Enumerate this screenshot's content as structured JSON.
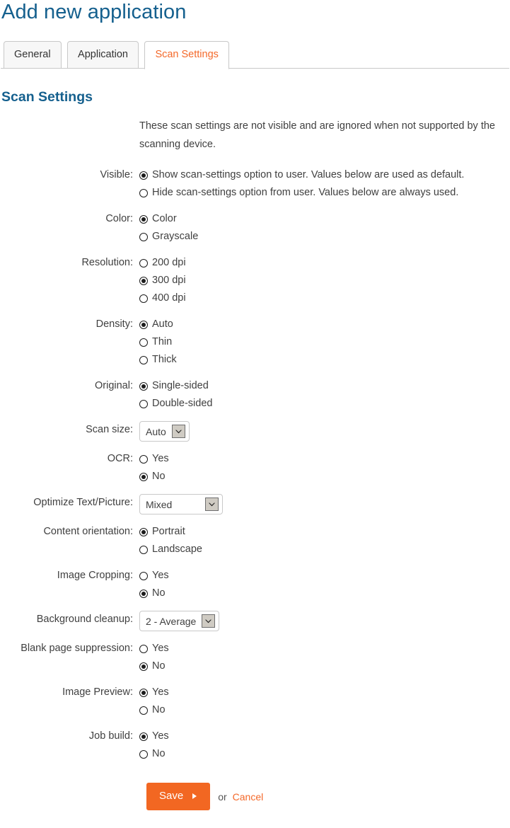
{
  "page": {
    "title": "Add new application",
    "section_heading": "Scan Settings"
  },
  "tabs": [
    {
      "label": "General",
      "active": false
    },
    {
      "label": "Application",
      "active": false
    },
    {
      "label": "Scan Settings",
      "active": true
    }
  ],
  "intro": {
    "text": "These scan settings are not visible and are ignored when not supported by the scanning device."
  },
  "fields": {
    "visible": {
      "label": "Visible:",
      "options": [
        {
          "text": "Show scan-settings option to user. Values below are used as default.",
          "selected": true
        },
        {
          "text": "Hide scan-settings option from user. Values below are always used.",
          "selected": false
        }
      ]
    },
    "color": {
      "label": "Color:",
      "options": [
        {
          "text": "Color",
          "selected": true
        },
        {
          "text": "Grayscale",
          "selected": false
        }
      ]
    },
    "resolution": {
      "label": "Resolution:",
      "options": [
        {
          "text": "200 dpi",
          "selected": false
        },
        {
          "text": "300 dpi",
          "selected": true
        },
        {
          "text": "400 dpi",
          "selected": false
        }
      ]
    },
    "density": {
      "label": "Density:",
      "options": [
        {
          "text": "Auto",
          "selected": true
        },
        {
          "text": "Thin",
          "selected": false
        },
        {
          "text": "Thick",
          "selected": false
        }
      ]
    },
    "original": {
      "label": "Original:",
      "options": [
        {
          "text": "Single-sided",
          "selected": true
        },
        {
          "text": "Double-sided",
          "selected": false
        }
      ]
    },
    "scan_size": {
      "label": "Scan size:",
      "value": "Auto"
    },
    "ocr": {
      "label": "OCR:",
      "options": [
        {
          "text": "Yes",
          "selected": false
        },
        {
          "text": "No",
          "selected": true
        }
      ]
    },
    "optimize": {
      "label": "Optimize Text/Picture:",
      "value": "Mixed"
    },
    "content_orientation": {
      "label": "Content orientation:",
      "options": [
        {
          "text": "Portrait",
          "selected": true
        },
        {
          "text": "Landscape",
          "selected": false
        }
      ]
    },
    "image_cropping": {
      "label": "Image Cropping:",
      "options": [
        {
          "text": "Yes",
          "selected": false
        },
        {
          "text": "No",
          "selected": true
        }
      ]
    },
    "background_cleanup": {
      "label": "Background cleanup:",
      "value": "2 - Average"
    },
    "blank_page_suppression": {
      "label": "Blank page suppression:",
      "options": [
        {
          "text": "Yes",
          "selected": false
        },
        {
          "text": "No",
          "selected": true
        }
      ]
    },
    "image_preview": {
      "label": "Image Preview:",
      "options": [
        {
          "text": "Yes",
          "selected": true
        },
        {
          "text": "No",
          "selected": false
        }
      ]
    },
    "job_build": {
      "label": "Job build:",
      "options": [
        {
          "text": "Yes",
          "selected": true
        },
        {
          "text": "No",
          "selected": false
        }
      ]
    }
  },
  "actions": {
    "save_label": "Save",
    "or_label": "or",
    "cancel_label": "Cancel"
  },
  "colors": {
    "heading_blue": "#15608e",
    "accent_orange": "#f26722",
    "tab_active_text": "#f4692a",
    "border_gray": "#c8c8c8"
  }
}
